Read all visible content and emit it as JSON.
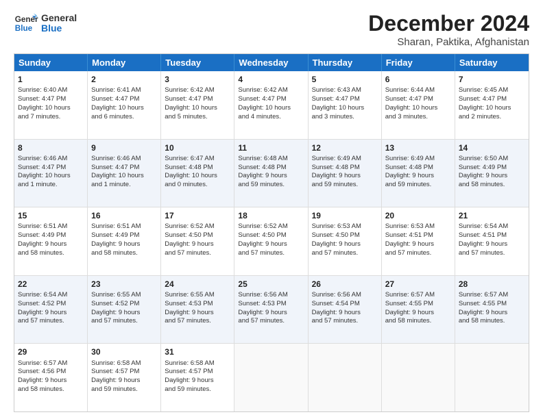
{
  "header": {
    "logo_general": "General",
    "logo_blue": "Blue",
    "month_title": "December 2024",
    "location": "Sharan, Paktika, Afghanistan"
  },
  "days_of_week": [
    "Sunday",
    "Monday",
    "Tuesday",
    "Wednesday",
    "Thursday",
    "Friday",
    "Saturday"
  ],
  "weeks": [
    [
      {
        "day": "1",
        "lines": [
          "Sunrise: 6:40 AM",
          "Sunset: 4:47 PM",
          "Daylight: 10 hours",
          "and 7 minutes."
        ]
      },
      {
        "day": "2",
        "lines": [
          "Sunrise: 6:41 AM",
          "Sunset: 4:47 PM",
          "Daylight: 10 hours",
          "and 6 minutes."
        ]
      },
      {
        "day": "3",
        "lines": [
          "Sunrise: 6:42 AM",
          "Sunset: 4:47 PM",
          "Daylight: 10 hours",
          "and 5 minutes."
        ]
      },
      {
        "day": "4",
        "lines": [
          "Sunrise: 6:42 AM",
          "Sunset: 4:47 PM",
          "Daylight: 10 hours",
          "and 4 minutes."
        ]
      },
      {
        "day": "5",
        "lines": [
          "Sunrise: 6:43 AM",
          "Sunset: 4:47 PM",
          "Daylight: 10 hours",
          "and 3 minutes."
        ]
      },
      {
        "day": "6",
        "lines": [
          "Sunrise: 6:44 AM",
          "Sunset: 4:47 PM",
          "Daylight: 10 hours",
          "and 3 minutes."
        ]
      },
      {
        "day": "7",
        "lines": [
          "Sunrise: 6:45 AM",
          "Sunset: 4:47 PM",
          "Daylight: 10 hours",
          "and 2 minutes."
        ]
      }
    ],
    [
      {
        "day": "8",
        "lines": [
          "Sunrise: 6:46 AM",
          "Sunset: 4:47 PM",
          "Daylight: 10 hours",
          "and 1 minute."
        ]
      },
      {
        "day": "9",
        "lines": [
          "Sunrise: 6:46 AM",
          "Sunset: 4:47 PM",
          "Daylight: 10 hours",
          "and 1 minute."
        ]
      },
      {
        "day": "10",
        "lines": [
          "Sunrise: 6:47 AM",
          "Sunset: 4:48 PM",
          "Daylight: 10 hours",
          "and 0 minutes."
        ]
      },
      {
        "day": "11",
        "lines": [
          "Sunrise: 6:48 AM",
          "Sunset: 4:48 PM",
          "Daylight: 9 hours",
          "and 59 minutes."
        ]
      },
      {
        "day": "12",
        "lines": [
          "Sunrise: 6:49 AM",
          "Sunset: 4:48 PM",
          "Daylight: 9 hours",
          "and 59 minutes."
        ]
      },
      {
        "day": "13",
        "lines": [
          "Sunrise: 6:49 AM",
          "Sunset: 4:48 PM",
          "Daylight: 9 hours",
          "and 59 minutes."
        ]
      },
      {
        "day": "14",
        "lines": [
          "Sunrise: 6:50 AM",
          "Sunset: 4:49 PM",
          "Daylight: 9 hours",
          "and 58 minutes."
        ]
      }
    ],
    [
      {
        "day": "15",
        "lines": [
          "Sunrise: 6:51 AM",
          "Sunset: 4:49 PM",
          "Daylight: 9 hours",
          "and 58 minutes."
        ]
      },
      {
        "day": "16",
        "lines": [
          "Sunrise: 6:51 AM",
          "Sunset: 4:49 PM",
          "Daylight: 9 hours",
          "and 58 minutes."
        ]
      },
      {
        "day": "17",
        "lines": [
          "Sunrise: 6:52 AM",
          "Sunset: 4:50 PM",
          "Daylight: 9 hours",
          "and 57 minutes."
        ]
      },
      {
        "day": "18",
        "lines": [
          "Sunrise: 6:52 AM",
          "Sunset: 4:50 PM",
          "Daylight: 9 hours",
          "and 57 minutes."
        ]
      },
      {
        "day": "19",
        "lines": [
          "Sunrise: 6:53 AM",
          "Sunset: 4:50 PM",
          "Daylight: 9 hours",
          "and 57 minutes."
        ]
      },
      {
        "day": "20",
        "lines": [
          "Sunrise: 6:53 AM",
          "Sunset: 4:51 PM",
          "Daylight: 9 hours",
          "and 57 minutes."
        ]
      },
      {
        "day": "21",
        "lines": [
          "Sunrise: 6:54 AM",
          "Sunset: 4:51 PM",
          "Daylight: 9 hours",
          "and 57 minutes."
        ]
      }
    ],
    [
      {
        "day": "22",
        "lines": [
          "Sunrise: 6:54 AM",
          "Sunset: 4:52 PM",
          "Daylight: 9 hours",
          "and 57 minutes."
        ]
      },
      {
        "day": "23",
        "lines": [
          "Sunrise: 6:55 AM",
          "Sunset: 4:52 PM",
          "Daylight: 9 hours",
          "and 57 minutes."
        ]
      },
      {
        "day": "24",
        "lines": [
          "Sunrise: 6:55 AM",
          "Sunset: 4:53 PM",
          "Daylight: 9 hours",
          "and 57 minutes."
        ]
      },
      {
        "day": "25",
        "lines": [
          "Sunrise: 6:56 AM",
          "Sunset: 4:53 PM",
          "Daylight: 9 hours",
          "and 57 minutes."
        ]
      },
      {
        "day": "26",
        "lines": [
          "Sunrise: 6:56 AM",
          "Sunset: 4:54 PM",
          "Daylight: 9 hours",
          "and 57 minutes."
        ]
      },
      {
        "day": "27",
        "lines": [
          "Sunrise: 6:57 AM",
          "Sunset: 4:55 PM",
          "Daylight: 9 hours",
          "and 58 minutes."
        ]
      },
      {
        "day": "28",
        "lines": [
          "Sunrise: 6:57 AM",
          "Sunset: 4:55 PM",
          "Daylight: 9 hours",
          "and 58 minutes."
        ]
      }
    ],
    [
      {
        "day": "29",
        "lines": [
          "Sunrise: 6:57 AM",
          "Sunset: 4:56 PM",
          "Daylight: 9 hours",
          "and 58 minutes."
        ]
      },
      {
        "day": "30",
        "lines": [
          "Sunrise: 6:58 AM",
          "Sunset: 4:57 PM",
          "Daylight: 9 hours",
          "and 59 minutes."
        ]
      },
      {
        "day": "31",
        "lines": [
          "Sunrise: 6:58 AM",
          "Sunset: 4:57 PM",
          "Daylight: 9 hours",
          "and 59 minutes."
        ]
      },
      {
        "day": "",
        "lines": []
      },
      {
        "day": "",
        "lines": []
      },
      {
        "day": "",
        "lines": []
      },
      {
        "day": "",
        "lines": []
      }
    ]
  ]
}
